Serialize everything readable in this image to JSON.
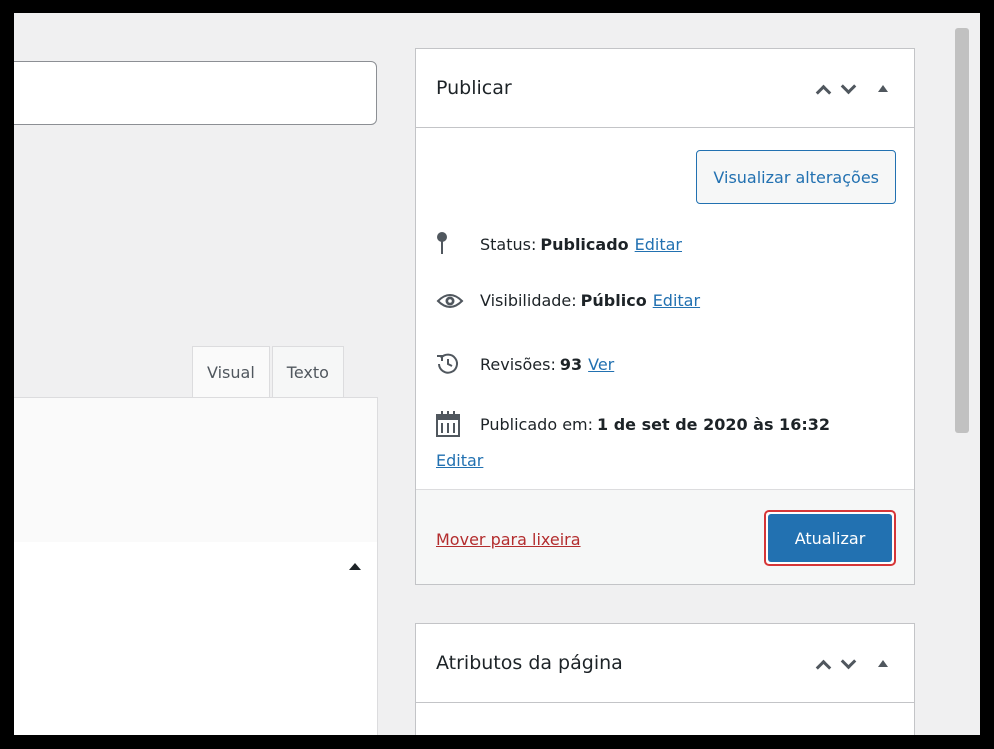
{
  "editor": {
    "tabs": [
      {
        "label": "Visual"
      },
      {
        "label": "Texto"
      }
    ]
  },
  "publish_box": {
    "title": "Publicar",
    "preview_button": "Visualizar alterações",
    "status": {
      "label": "Status:",
      "value": "Publicado",
      "link": "Editar"
    },
    "visibility": {
      "label": "Visibilidade:",
      "value": "Público",
      "link": "Editar"
    },
    "revisions": {
      "label": "Revisões:",
      "value": "93",
      "link": "Ver"
    },
    "published_on": {
      "label": "Publicado em:",
      "value": "1 de set de 2020 às 16:32",
      "link": "Editar"
    },
    "trash_link": "Mover para lixeira",
    "update_button": "Atualizar"
  },
  "attributes_box": {
    "title": "Atributos da página"
  },
  "colors": {
    "accent": "#2271b1",
    "danger": "#b32d2e",
    "highlight_outline": "#d63638"
  },
  "icons": {
    "status": "pin-icon",
    "visibility": "eye-icon",
    "revisions": "history-icon",
    "published_on": "calendar-icon"
  }
}
